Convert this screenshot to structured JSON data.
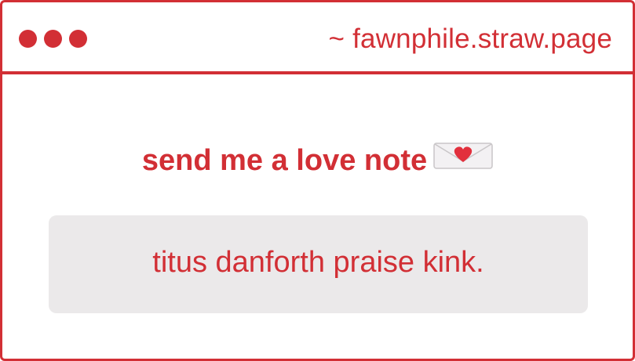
{
  "window": {
    "url": "~ fawnphile.straw.page",
    "accent_color": "#d22f35"
  },
  "main": {
    "heading": "send me a love note",
    "heading_icon": "love-letter-icon",
    "note_text": "titus danforth praise kink."
  },
  "colors": {
    "accent": "#d22f35",
    "note_background": "#ebe9ea",
    "background": "#ffffff"
  }
}
